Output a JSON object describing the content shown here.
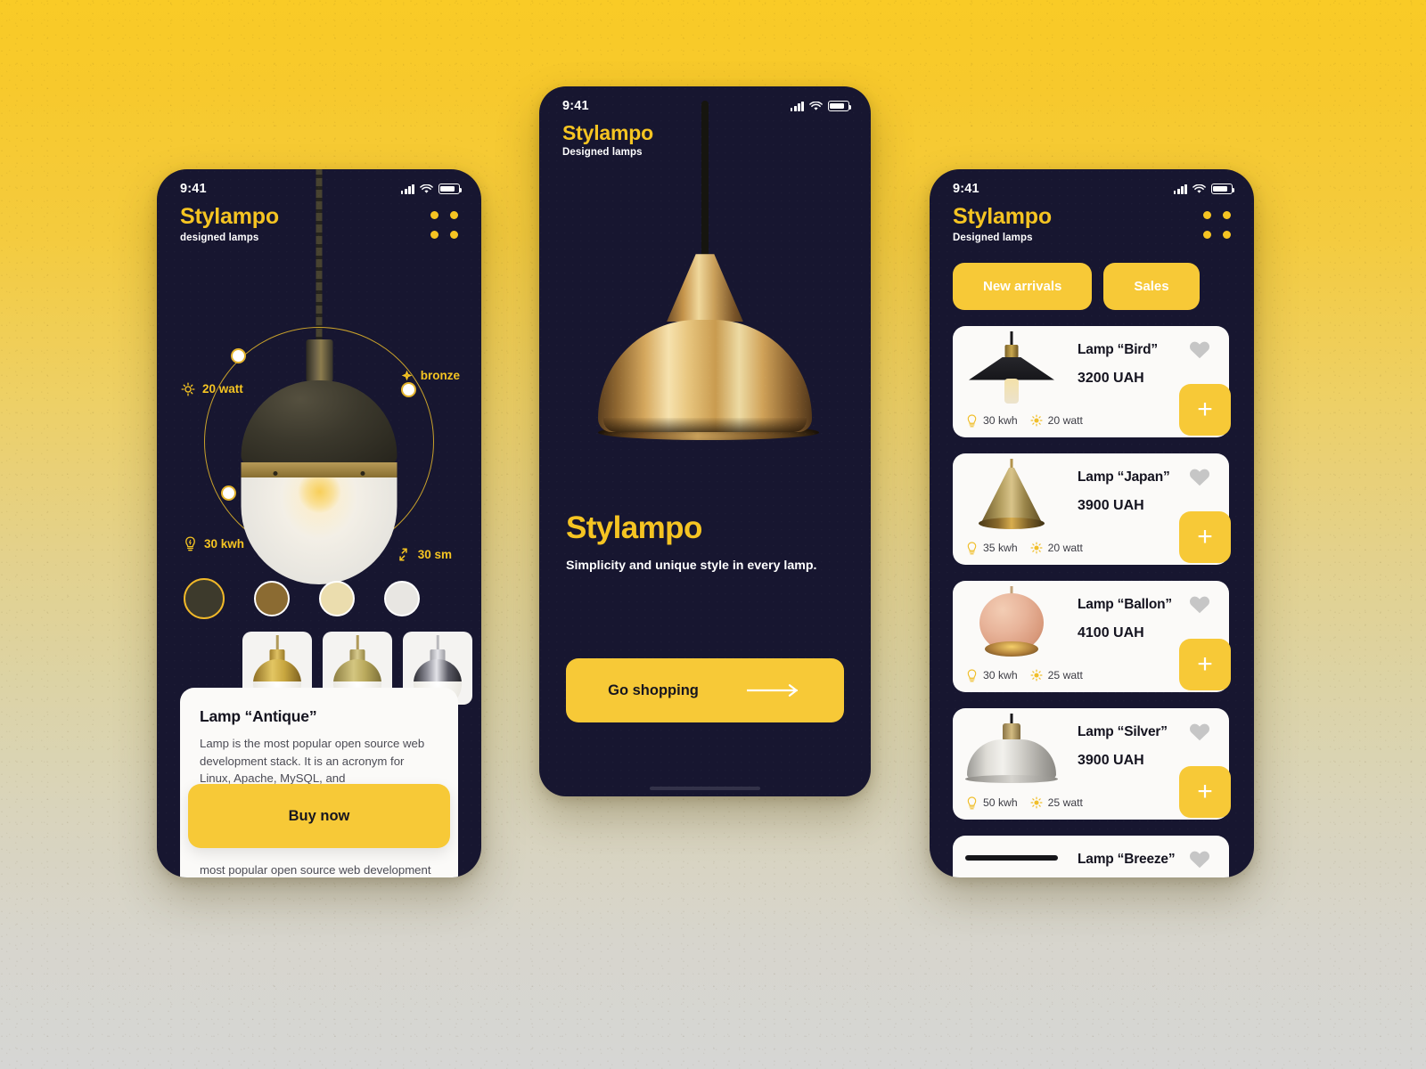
{
  "background": {
    "top_color": "#F9CB26",
    "bottom_color": "#D6D6D4"
  },
  "theme": {
    "navy": "#171630",
    "yellow": "#F7C937",
    "brand_yellow": "#F5C422",
    "card_white": "#FBFAF8",
    "heart_grey": "#C6C6C6"
  },
  "phone1": {
    "status": {
      "time": "9:41",
      "signal_icon": "cellular-bars-icon",
      "wifi_icon": "wifi-icon",
      "battery_icon": "battery-icon"
    },
    "brand": {
      "name": "Stylampo",
      "tagline": "designed lamps"
    },
    "menu_icon": "four-dot-grid-icon",
    "specs": [
      {
        "id": "watt",
        "icon": "bulb-icon",
        "label": "20 watt"
      },
      {
        "id": "bronze",
        "icon": "material-icon",
        "label": "bronze"
      },
      {
        "id": "kwh",
        "icon": "energy-icon",
        "label": "30 kwh"
      },
      {
        "id": "size",
        "icon": "resize-icon",
        "label": "30 sm"
      }
    ],
    "swatches": [
      {
        "name": "dark-olive",
        "hex": "#3D3A2C",
        "selected": true
      },
      {
        "name": "bronze",
        "hex": "#8B6B32",
        "selected": false
      },
      {
        "name": "cream",
        "hex": "#EBDDAE",
        "selected": false
      },
      {
        "name": "white",
        "hex": "#E8E6E2",
        "selected": false
      }
    ],
    "thumbs": [
      {
        "name": "brass-lamp",
        "cap": "#c9a338",
        "dome": "#c9a338"
      },
      {
        "name": "antique-brass-lamp",
        "cap": "#b79a4e",
        "dome": "#b8a257"
      },
      {
        "name": "chrome-lamp",
        "cap": "#c9c9cd",
        "dome": "#3a3a40"
      }
    ],
    "product": {
      "title": "Lamp “Antique”",
      "description": "Lamp is the most popular open source web development stack. It is an acronym for Linux, Apache, MySQL, and PHP/Perl/Python. All the",
      "description_2": "most popular open source web development stack. It is an acronym for Linux, Apache, MySQL and PHP/Perl/Python. All the",
      "buy_label": "Buy now"
    }
  },
  "phone2": {
    "status": {
      "time": "9:41"
    },
    "brand": {
      "name": "Stylampo",
      "tagline": "Designed lamps"
    },
    "hero": {
      "title": "Stylampo",
      "subtitle": "Simplicity and unique style in every lamp."
    },
    "cta": {
      "label": "Go shopping",
      "icon": "arrow-right-icon"
    }
  },
  "phone3": {
    "status": {
      "time": "9:41"
    },
    "brand": {
      "name": "Stylampo",
      "tagline": "Designed lamps"
    },
    "menu_icon": "four-dot-grid-icon",
    "tabs": [
      {
        "label": "New arrivals",
        "active": true
      },
      {
        "label": "Sales",
        "active": false
      }
    ],
    "products": [
      {
        "name": "Lamp “Bird”",
        "price": "3200 UAH",
        "kwh": "30 kwh",
        "watt": "20 watt",
        "favorite": false,
        "style": "bird"
      },
      {
        "name": "Lamp “Japan”",
        "price": "3900 UAH",
        "kwh": "35 kwh",
        "watt": "20 watt",
        "favorite": false,
        "style": "japan"
      },
      {
        "name": "Lamp “Ballon”",
        "price": "4100 UAH",
        "kwh": "30 kwh",
        "watt": "25 watt",
        "favorite": false,
        "style": "ballon"
      },
      {
        "name": "Lamp “Silver”",
        "price": "3900 UAH",
        "kwh": "50 kwh",
        "watt": "25 watt",
        "favorite": false,
        "style": "silver"
      },
      {
        "name": "Lamp “Breeze”",
        "price": "",
        "kwh": "",
        "watt": "",
        "favorite": false,
        "style": "breeze"
      }
    ],
    "meta_icons": {
      "energy": "energy-icon",
      "watt": "bulb-icon"
    },
    "add_label": "+",
    "favorite_icon": "heart-icon"
  }
}
